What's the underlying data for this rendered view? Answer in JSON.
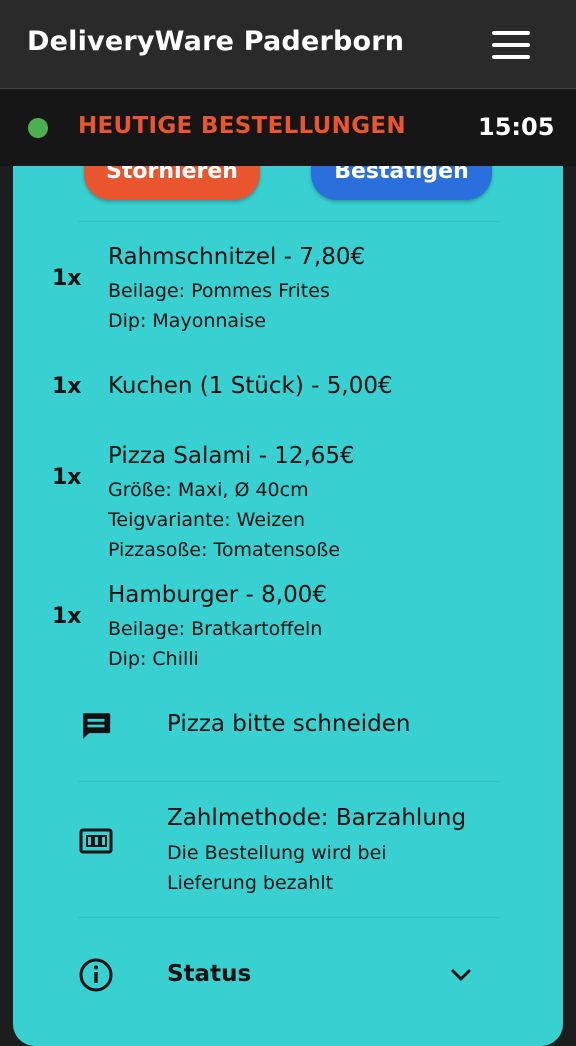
{
  "header": {
    "title": "DeliveryWare Paderborn",
    "menu_icon": "hamburger-menu-icon"
  },
  "subheader": {
    "status_color": "#4caf50",
    "title": "HEUTIGE BESTELLUNGEN",
    "title_color": "#e8552f",
    "time": "15:05"
  },
  "card": {
    "background": "#38d0d0",
    "cancel_label": "Stornieren",
    "cancel_color": "#e8552f",
    "confirm_label": "Bestätigen",
    "confirm_color": "#2a6fdb"
  },
  "items": [
    {
      "qty": "1x",
      "title": "Rahmschnitzel - 7,80€",
      "details": [
        "Beilage: Pommes Frites",
        "Dip: Mayonnaise"
      ]
    },
    {
      "qty": "1x",
      "title": "Kuchen (1 Stück) - 5,00€",
      "details": []
    },
    {
      "qty": "1x",
      "title": "Pizza Salami - 12,65€",
      "details": [
        "Größe: Maxi, Ø 40cm",
        "Teigvariante: Weizen",
        "Pizzasoße: Tomatensoße"
      ]
    },
    {
      "qty": "1x",
      "title": "Hamburger - 8,00€",
      "details": [
        "Beilage: Bratkartoffeln",
        "Dip: Chilli"
      ]
    }
  ],
  "comment": {
    "icon": "comment-icon",
    "text": "Pizza bitte schneiden"
  },
  "payment": {
    "icon": "cash-icon",
    "title": "Zahlmethode: Barzahlung",
    "line1": "Die Bestellung wird bei",
    "line2": "Lieferung bezahlt"
  },
  "status": {
    "icon": "info-icon",
    "label": "Status",
    "toggle_icon": "chevron-down-icon"
  }
}
